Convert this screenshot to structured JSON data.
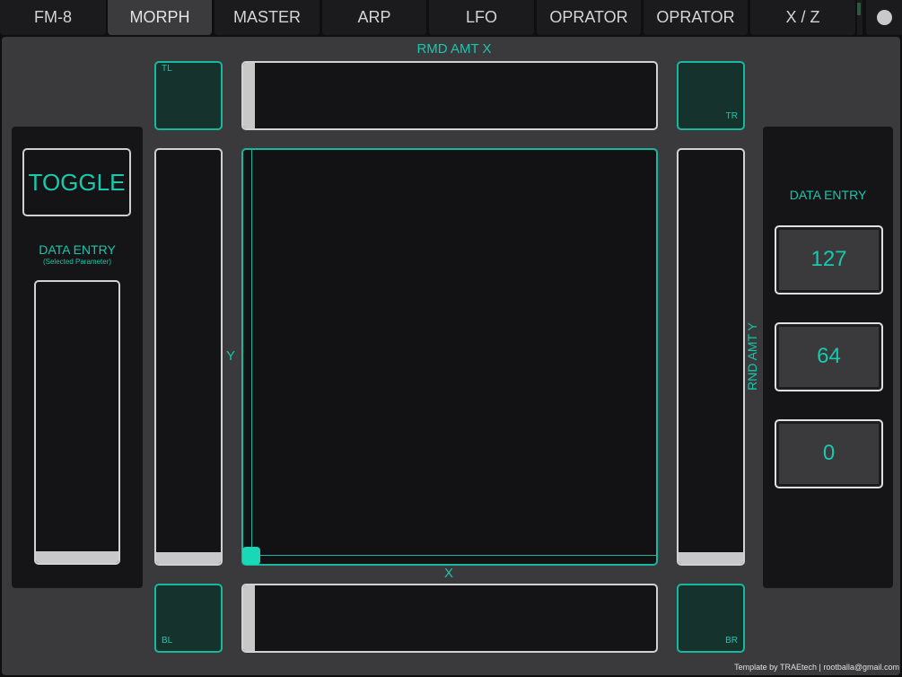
{
  "tabs": [
    {
      "label": "FM-8",
      "active": false
    },
    {
      "label": "MORPH",
      "active": true
    },
    {
      "label": "MASTER",
      "active": false
    },
    {
      "label": "ARP",
      "active": false
    },
    {
      "label": "LFO",
      "active": false
    },
    {
      "label": "OPRATOR",
      "active": false
    },
    {
      "label": "OPRATOR",
      "active": false
    },
    {
      "label": "X / Z",
      "active": false
    }
  ],
  "xy_pad": {
    "top_label": "RMD AMT X",
    "y_label": "Y",
    "x_label": "X",
    "right_label": "RND AMT Y",
    "x_value": 0.0,
    "y_value": 0.0
  },
  "corners": {
    "tl": "TL",
    "tr": "TR",
    "bl": "BL",
    "br": "BR"
  },
  "faders": {
    "top_x_amount": 0.0,
    "bottom_x": 0.0,
    "left_y": 0.0,
    "right_y_amount": 0.0,
    "data_entry": 0.0
  },
  "left_panel": {
    "toggle_label": "TOGGLE",
    "data_entry_title": "DATA ENTRY",
    "data_entry_subtitle": "(Selected Parameter)"
  },
  "right_panel": {
    "title": "DATA ENTRY",
    "values": [
      "127",
      "64",
      "0"
    ]
  },
  "footer": {
    "credit": "Template by TRAEtech | rootballa@gmail.com"
  },
  "colors": {
    "accent": "#17c7ad",
    "panel": "#3a3a3c",
    "pad_fill": "#15322d",
    "fader_handle": "#c8c8c8"
  }
}
